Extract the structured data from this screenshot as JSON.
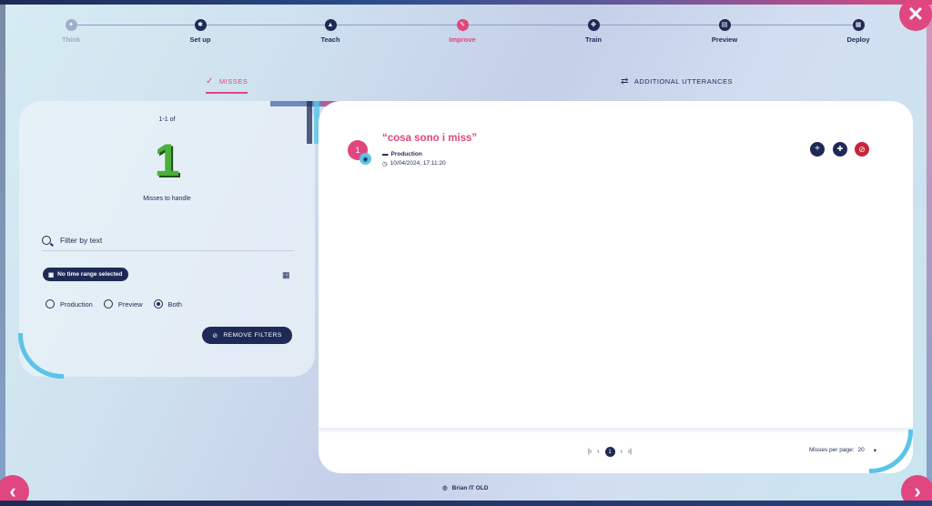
{
  "stepper": {
    "steps": [
      {
        "label": "Think",
        "state": "done",
        "icon": "lightbulb-icon"
      },
      {
        "label": "Set up",
        "state": "todo",
        "icon": "gear-icon"
      },
      {
        "label": "Teach",
        "state": "todo",
        "icon": "graduation-icon"
      },
      {
        "label": "Improve",
        "state": "active",
        "icon": "pencil-icon"
      },
      {
        "label": "Train",
        "state": "todo",
        "icon": "brain-icon"
      },
      {
        "label": "Preview",
        "state": "todo",
        "icon": "preview-icon"
      },
      {
        "label": "Deploy",
        "state": "todo",
        "icon": "deploy-icon"
      }
    ]
  },
  "tabs": {
    "misses": "MISSES",
    "additional_utterances": "ADDITIONAL UTTERANCES"
  },
  "summary": {
    "range_label": "1-1 of",
    "count": "1",
    "caption": "Misses to handle"
  },
  "filters": {
    "text_placeholder": "Filter by text",
    "time_range": "No time range selected",
    "environments": [
      {
        "label": "Production",
        "checked": false
      },
      {
        "label": "Preview",
        "checked": false
      },
      {
        "label": "Both",
        "checked": true
      }
    ],
    "remove_label": "REMOVE FILTERS"
  },
  "misses": [
    {
      "index": "1",
      "text": "“cosa sono i miss”",
      "environment": "Production",
      "datetime": "10/04/2024, 17:11:20"
    }
  ],
  "pagination": {
    "current_page": "1",
    "per_page_label": "Misses per page:",
    "per_page_value": "20"
  },
  "bot": {
    "name": "Brian IT OLD"
  },
  "colors": {
    "accent": "#e0467f",
    "primary": "#1e2a55",
    "highlight": "#5bc4e6",
    "success": "#4caf3a",
    "danger": "#c8253a"
  }
}
